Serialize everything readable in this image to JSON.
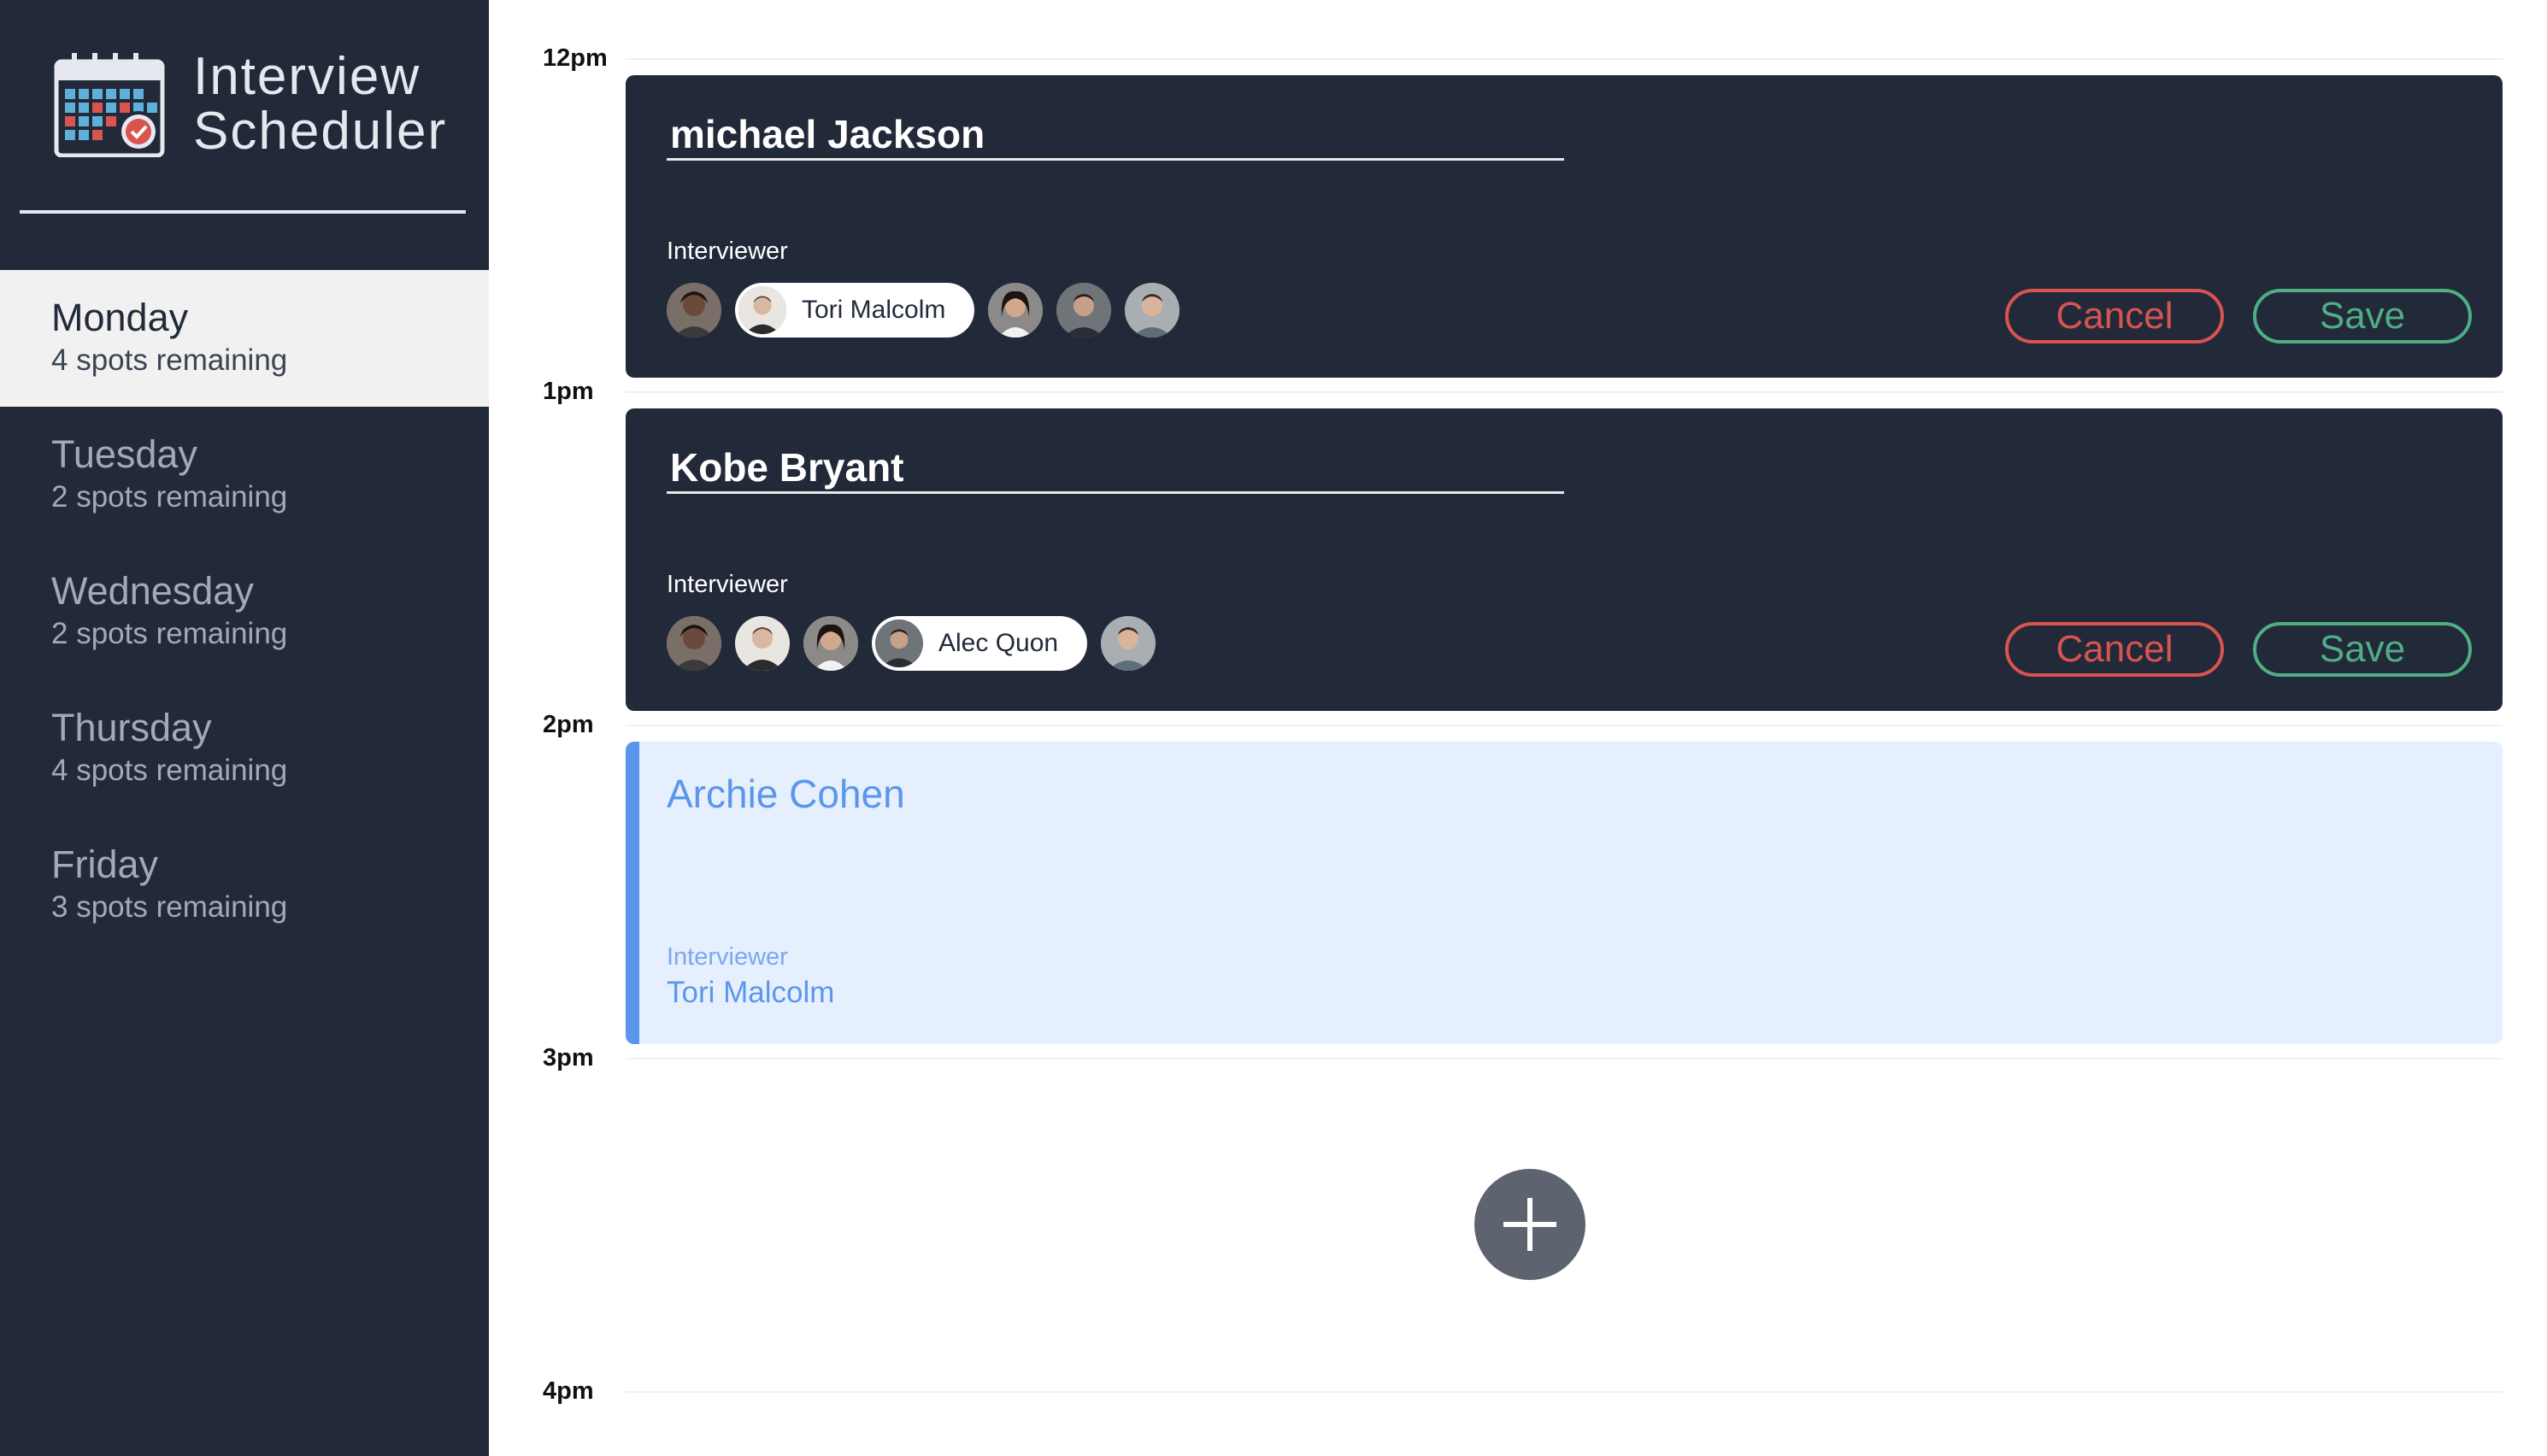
{
  "app": {
    "title_line1": "Interview",
    "title_line2": "Scheduler",
    "logo_icon": "calendar-check-icon"
  },
  "days": [
    {
      "name": "Monday",
      "spots": "4 spots remaining",
      "selected": true
    },
    {
      "name": "Tuesday",
      "spots": "2 spots remaining",
      "selected": false
    },
    {
      "name": "Wednesday",
      "spots": "2 spots remaining",
      "selected": false
    },
    {
      "name": "Thursday",
      "spots": "4 spots remaining",
      "selected": false
    },
    {
      "name": "Friday",
      "spots": "3 spots remaining",
      "selected": false
    }
  ],
  "times": [
    "12pm",
    "1pm",
    "2pm",
    "3pm",
    "4pm"
  ],
  "appointments": [
    {
      "mode": "edit",
      "student": "michael Jackson",
      "interviewer_label": "Interviewer",
      "selected_interviewer": "Tori Malcolm",
      "cancel_label": "Cancel",
      "save_label": "Save"
    },
    {
      "mode": "edit",
      "student": "Kobe Bryant",
      "interviewer_label": "Interviewer",
      "selected_interviewer": "Alec Quon",
      "cancel_label": "Cancel",
      "save_label": "Save"
    },
    {
      "mode": "show",
      "student": "Archie Cohen",
      "interviewer_label": "Interviewer",
      "interviewer": "Tori Malcolm"
    }
  ],
  "add_button": {
    "icon": "plus-icon"
  },
  "colors": {
    "sidebar_bg": "#222a3a",
    "selected_day_bg": "#f1f1f1",
    "cancel": "#d9534f",
    "save": "#4fae84",
    "show_card_bg": "#e6effd",
    "show_accent": "#5a97ec",
    "add_button_bg": "#5d646f"
  }
}
